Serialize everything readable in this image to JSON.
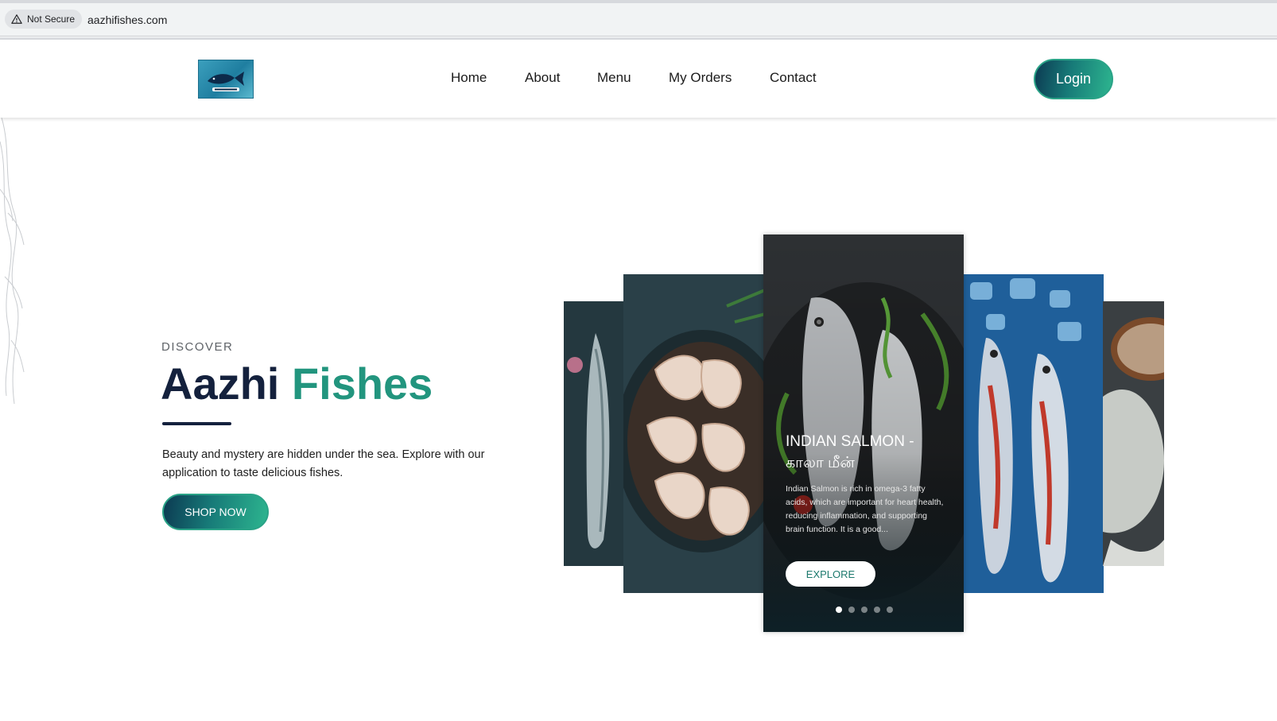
{
  "browser": {
    "security_label": "Not Secure",
    "url": "aazhifishes.com"
  },
  "header": {
    "logo_alt": "Aazhi Fishes logo",
    "nav": [
      {
        "label": "Home"
      },
      {
        "label": "About"
      },
      {
        "label": "Menu"
      },
      {
        "label": "My Orders"
      },
      {
        "label": "Contact"
      }
    ],
    "login_label": "Login"
  },
  "hero": {
    "eyebrow": "DISCOVER",
    "title_part1": "Aazhi",
    "title_part2": "Fishes",
    "description": "Beauty and mystery are hidden under the sea. Explore with our application to taste delicious fishes.",
    "cta_label": "SHOP NOW"
  },
  "carousel": {
    "active_card": {
      "title": "INDIAN SALMON - காலா மீன்",
      "description": "Indian Salmon is rich in omega-3 fatty acids, which are important for heart health, reducing inflammation, and supporting brain function. It is a good...",
      "button_label": "EXPLORE"
    },
    "slide_count": 5,
    "active_index": 0
  },
  "colors": {
    "brand_dark": "#14213d",
    "brand_teal": "#22957e",
    "button_gradient_start": "#0c3a52",
    "button_gradient_end": "#2db58f"
  }
}
